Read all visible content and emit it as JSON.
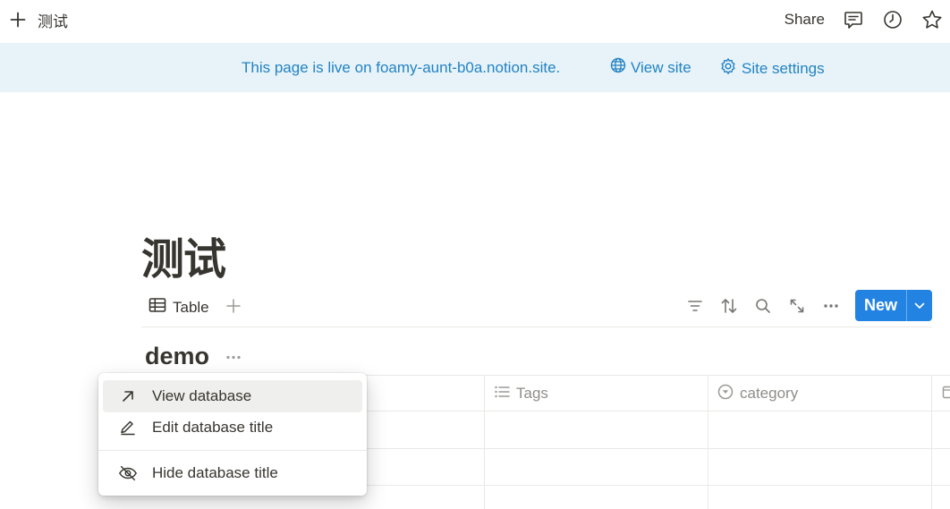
{
  "topbar": {
    "page_title": "测试",
    "share_label": "Share",
    "icons": [
      "plus-icon",
      "comment-icon",
      "clock-icon",
      "star-icon"
    ]
  },
  "banner": {
    "message": "This page is live on foamy-aunt-b0a.notion.site.",
    "view_site": "View site",
    "site_settings": "Site settings",
    "color": "#2383c4",
    "background": "#e7f3f8"
  },
  "page": {
    "title": "测试"
  },
  "viewbar": {
    "tab_label": "Table",
    "new_label": "New",
    "accent": "#2383e2",
    "tools": [
      "filter-icon",
      "sort-icon",
      "search-icon",
      "expand-icon",
      "more-icon"
    ]
  },
  "database": {
    "title": "demo",
    "columns": [
      {
        "label": "Tags",
        "icon": "list-icon"
      },
      {
        "label": "category",
        "icon": "select-icon"
      }
    ]
  },
  "menu": {
    "items": [
      {
        "label": "View database",
        "icon": "arrow-up-right-icon"
      },
      {
        "label": "Edit database title",
        "icon": "pencil-icon"
      },
      {
        "label": "Hide database title",
        "icon": "eye-off-icon"
      }
    ]
  }
}
